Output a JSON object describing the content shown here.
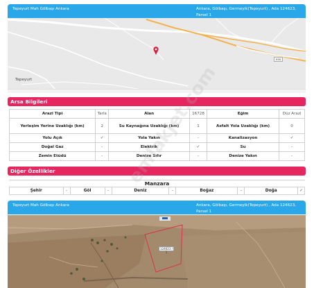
{
  "header1": {
    "left": "Tepeyurt Mah Gölbaşı Ankara",
    "right": "Ankara, Gölbaşı, Germeyik(Tepeyurt) , Ada 124623, Parsel 1"
  },
  "map": {
    "place_label": "Tepeyurt",
    "road_badge": "E90",
    "marker": "location-pin"
  },
  "arsa": {
    "title": "Arsa Bilgileri",
    "rows": [
      [
        {
          "label": "Arazi Tipi",
          "value": "Tarla"
        },
        {
          "label": "Alan",
          "value": "16728"
        },
        {
          "label": "Eğim",
          "value": "Düz Arazi"
        }
      ],
      [
        {
          "label": "Yerleşim Yerine Uzaklığı (km)",
          "value": "2"
        },
        {
          "label": "Su Kaynağına Uzaklığı (km)",
          "value": "1"
        },
        {
          "label": "Asfalt Yola Uzaklığı (km)",
          "value": "0"
        }
      ],
      [
        {
          "label": "Yolu Açık",
          "value": "✓"
        },
        {
          "label": "Yola Yakın",
          "value": "-"
        },
        {
          "label": "Kanalizasyon",
          "value": "✓"
        }
      ],
      [
        {
          "label": "Doğal Gaz",
          "value": "-"
        },
        {
          "label": "Elektrik",
          "value": "✓"
        },
        {
          "label": "Su",
          "value": "-"
        }
      ],
      [
        {
          "label": "Zemin Etüdü",
          "value": "-"
        },
        {
          "label": "Denize Sıfır",
          "value": "-"
        },
        {
          "label": "Denize Yakın",
          "value": "-"
        }
      ]
    ]
  },
  "diger": {
    "title": "Diğer Özellikler",
    "manzara_title": "Manzara",
    "items": [
      {
        "label": "Şehir",
        "value": "-"
      },
      {
        "label": "Göl",
        "value": "-"
      },
      {
        "label": "Deniz",
        "value": "-"
      },
      {
        "label": "Boğaz",
        "value": "-"
      },
      {
        "label": "Doğa",
        "value": "✓"
      }
    ]
  },
  "header2": {
    "left": "Tepeyurt Mah Gölbaşı Ankara",
    "right": "Ankara, Gölbaşı, Germeyik(Tepeyurt) , Ada 124623, Parsel 1"
  },
  "satellite": {
    "parcel_label": "124623 / 1"
  },
  "watermark": "emlakjet.com",
  "colors": {
    "header_blue": "#2aa7e8",
    "section_pink": "#e5265f"
  }
}
